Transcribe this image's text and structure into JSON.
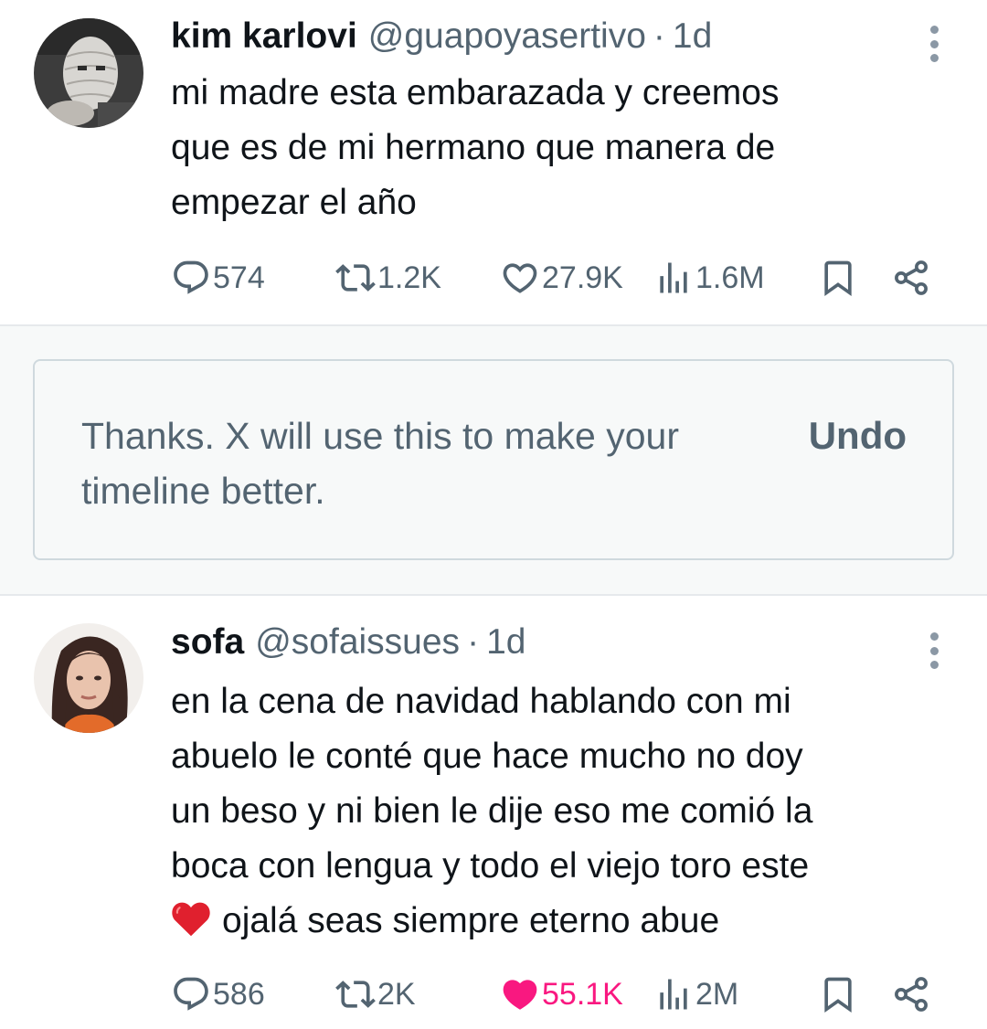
{
  "tweets": [
    {
      "name": "kim karlovi",
      "handle": "@guapoyasertivo",
      "separator": "·",
      "time": "1d",
      "text_lines": [
        "mi madre esta embarazada y creemos",
        "que es de mi hermano que manera de",
        "empezar el año"
      ],
      "stats": {
        "replies": "574",
        "reposts": "1.2K",
        "likes": "27.9K",
        "views": "1.6M"
      },
      "liked": false
    },
    {
      "name": "sofa",
      "handle": "@sofaissues",
      "separator": "·",
      "time": "1d",
      "text_lines": [
        "en la cena de navidad hablando con mi",
        "abuelo le conté que hace mucho no doy",
        "un beso y ni bien le dije eso me comió la",
        "boca con lengua y todo el viejo toro este",
        "ojalá seas siempre eterno abue"
      ],
      "emoji": "red-heart",
      "stats": {
        "replies": "586",
        "reposts": "2K",
        "likes": "55.1K",
        "views": "2M"
      },
      "liked": true
    }
  ],
  "feedback": {
    "message_line1": "Thanks. X will use this to make your",
    "message_line2": "timeline better.",
    "undo_label": "Undo"
  },
  "colors": {
    "text": "#0f1419",
    "secondary": "#536471",
    "like_active": "#f91880",
    "divider": "#e6e9ec",
    "band": "#f7f9f9",
    "box_border": "#cfd9de"
  },
  "icons": [
    "reply-icon",
    "repost-icon",
    "like-icon",
    "views-icon",
    "bookmark-icon",
    "share-icon",
    "more-icon"
  ]
}
